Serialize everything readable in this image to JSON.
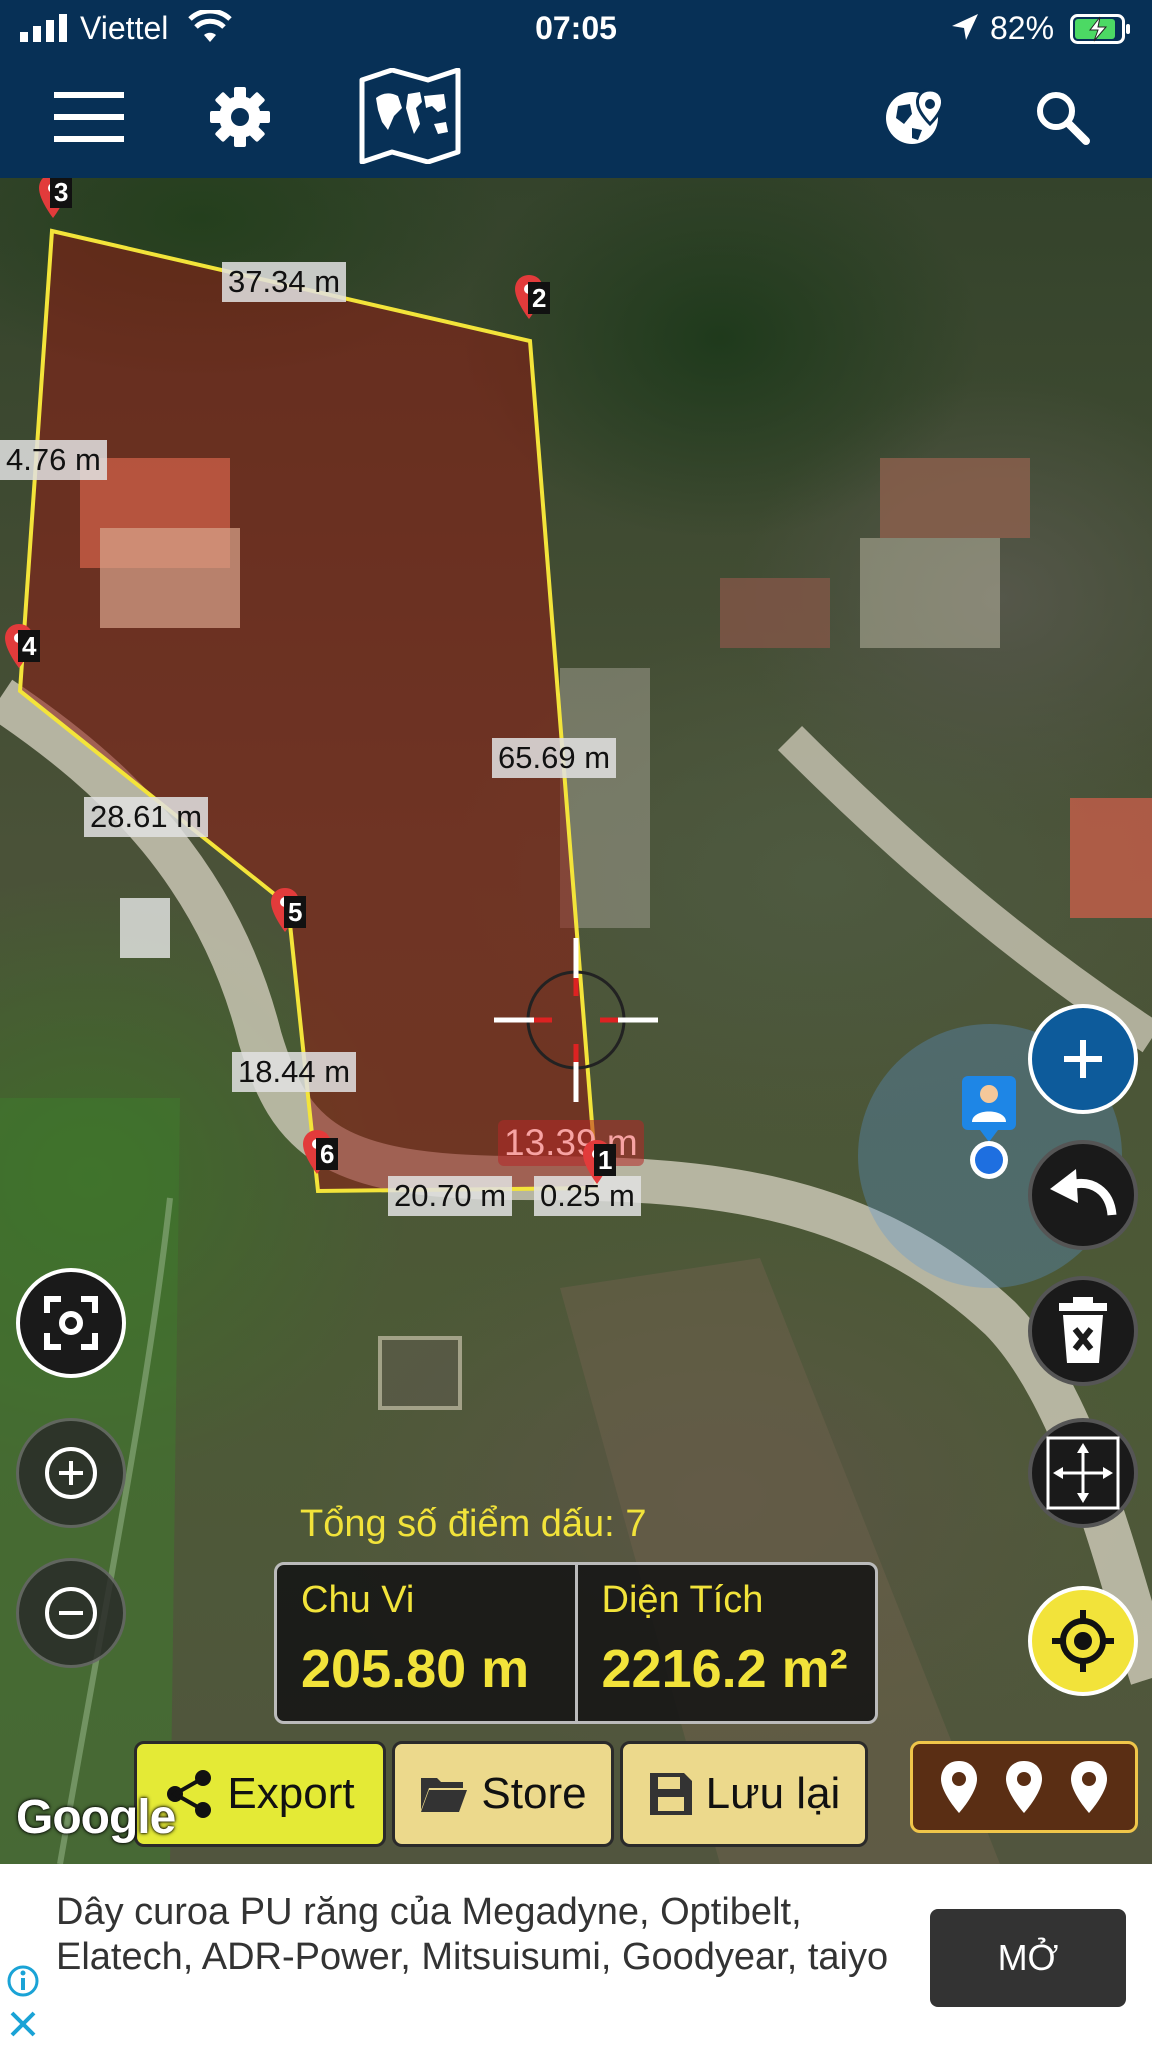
{
  "status_bar": {
    "carrier": "Viettel",
    "time": "07:05",
    "battery_pct": "82%"
  },
  "toolbar": {
    "icons": [
      "menu-icon",
      "gear-icon",
      "world-map-icon",
      "globe-pin-icon",
      "search-icon"
    ]
  },
  "map": {
    "distances": [
      "37.34 m",
      "4.76 m",
      "65.69 m",
      "28.61 m",
      "18.44 m",
      "13.39 m",
      "20.70 m",
      "0.25 m"
    ],
    "pins": [
      "1",
      "2",
      "3",
      "4",
      "5",
      "6"
    ],
    "colors": {
      "polygon_stroke": "#f3e43a",
      "polygon_fill": "#8e1c14",
      "pin": "#e23b3b",
      "live_distance": "#f7a3a3"
    }
  },
  "summary": {
    "total_label": "Tổng số điểm dấu:",
    "total_count": "7",
    "perimeter_label": "Chu Vi",
    "perimeter_value": "205.80 m",
    "area_label": "Diện Tích",
    "area_value": "2216.2 m²"
  },
  "actions": {
    "export": "Export",
    "store": "Store",
    "save": "Lưu lại"
  },
  "map_attribution": "Google",
  "ad": {
    "text": "Dây curoa PU răng của Megadyne, Optibelt, Elatech, ADR-Power, Mitsuisumi, Goodyear, taiyo",
    "button": "MỞ"
  },
  "colors": {
    "toolbar": "#073056",
    "accent_yellow": "#f2e33a",
    "export_bg": "#e4ea36",
    "button_bg": "#ecd98c"
  }
}
